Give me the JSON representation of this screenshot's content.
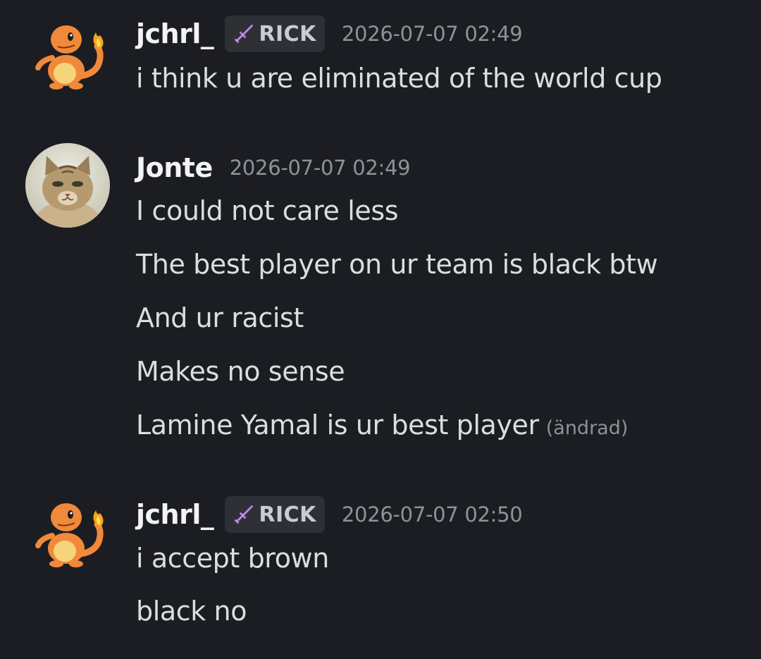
{
  "messages": [
    {
      "author": "jchrl_",
      "avatar": "charmander-avatar",
      "tag": "RICK",
      "tag_icon": "sword-icon",
      "timestamp": "2026-07-07 02:49",
      "lines": [
        "i think u are eliminated of the world cup"
      ]
    },
    {
      "author": "Jonte",
      "avatar": "cat-avatar",
      "timestamp": "2026-07-07 02:49",
      "lines": [
        "I could not care less",
        "The best player on ur team is black btw",
        "And ur racist",
        "Makes no sense",
        "Lamine Yamal is ur best player"
      ],
      "edited_label": "(ändrad)"
    },
    {
      "author": "jchrl_",
      "avatar": "charmander-avatar",
      "tag": "RICK",
      "tag_icon": "sword-icon",
      "timestamp": "2026-07-07 02:50",
      "lines": [
        "i accept brown",
        "black no"
      ]
    }
  ],
  "colors": {
    "background": "#1c1d22",
    "username": "#f2f3f5",
    "message_text": "#dbdee1",
    "timestamp": "#8e9297",
    "tag_background": "#2e3036",
    "tag_icon": "#d9b8f0"
  }
}
